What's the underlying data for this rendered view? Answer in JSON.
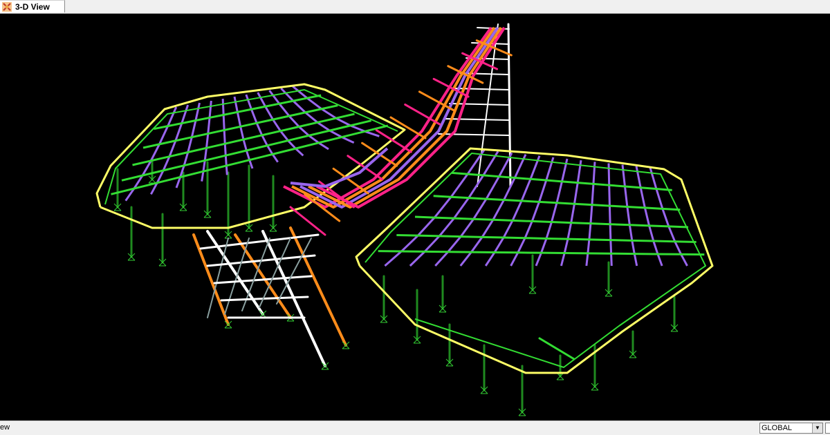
{
  "tab": {
    "label": "3-D View",
    "icon": "etabs-app-icon"
  },
  "status": {
    "text": "ew"
  },
  "coord_system": {
    "selected": "GLOBAL",
    "arrow": "▼"
  },
  "colors": {
    "background": "#000000",
    "edge_beam": "#ffff66",
    "primary_beam": "#33dd33",
    "secondary_beam": "#9966ee",
    "brace_orange": "#ff8c1a",
    "brace_magenta": "#ff2288",
    "white_frame": "#ffffff",
    "column": "#1f8a1f",
    "support": "#33cc33"
  }
}
